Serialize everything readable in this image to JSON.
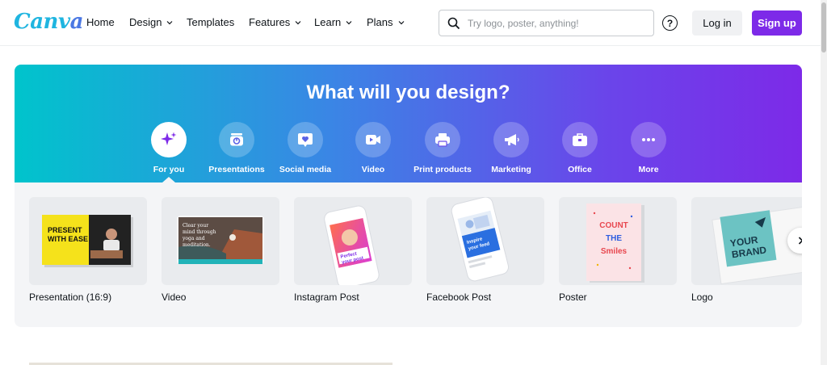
{
  "brand": {
    "logo_text_1": "Canv",
    "logo_text_2": "a"
  },
  "nav": {
    "items": [
      {
        "label": "Home"
      },
      {
        "label": "Design"
      },
      {
        "label": "Templates"
      },
      {
        "label": "Features"
      },
      {
        "label": "Learn"
      },
      {
        "label": "Plans"
      }
    ],
    "search_placeholder": "Try logo, poster, anything!",
    "help_glyph": "?",
    "login_label": "Log in",
    "signup_label": "Sign up"
  },
  "hero": {
    "title": "What will you design?",
    "categories": [
      {
        "label": "For you",
        "icon": "sparkle-icon"
      },
      {
        "label": "Presentations",
        "icon": "presentation-icon"
      },
      {
        "label": "Social media",
        "icon": "heart-chat-icon"
      },
      {
        "label": "Video",
        "icon": "video-camera-icon"
      },
      {
        "label": "Print products",
        "icon": "printer-icon"
      },
      {
        "label": "Marketing",
        "icon": "megaphone-icon"
      },
      {
        "label": "Office",
        "icon": "briefcase-icon"
      },
      {
        "label": "More",
        "icon": "more-icon"
      }
    ]
  },
  "templates": [
    {
      "label": "Presentation (16:9)",
      "thumb_text": "PRESENT WITH EASE"
    },
    {
      "label": "Video",
      "thumb_text": "Clear your mind through yoga and meditation."
    },
    {
      "label": "Instagram Post",
      "thumb_text": "Perfect your post"
    },
    {
      "label": "Facebook Post",
      "thumb_text": "Inspire your feed"
    },
    {
      "label": "Poster",
      "thumb_text": "COUNT THE Smiles"
    },
    {
      "label": "Logo",
      "thumb_text": "YOUR BRAND"
    }
  ],
  "colors": {
    "accent": "#7d2ae8",
    "gradient_start": "#00c4cc",
    "gradient_end": "#7d2ae8"
  }
}
